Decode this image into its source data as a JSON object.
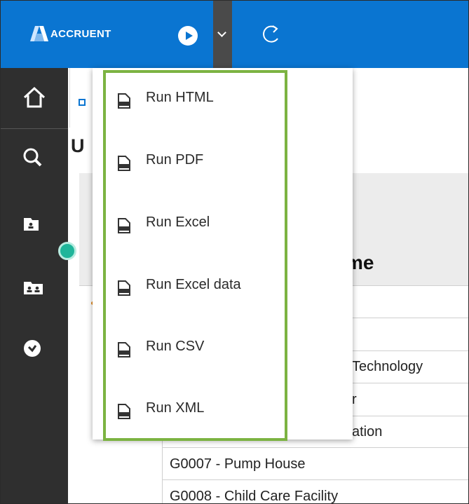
{
  "topbar": {
    "logo_text": "ACCRUENT",
    "brand_color": "#0a75d1"
  },
  "sidebar": {
    "items": [
      {
        "icon": "home-icon"
      },
      {
        "icon": "search-icon"
      },
      {
        "icon": "my-folder-icon"
      },
      {
        "icon": "team-folder-icon"
      },
      {
        "icon": "schedule-icon"
      }
    ]
  },
  "content": {
    "page_title_partial": "U",
    "column_header_partial": "me"
  },
  "table": {
    "rows_partial": [
      "Technology",
      "r",
      "ation"
    ],
    "rows": [
      "G0007 - Pump House",
      "G0008 - Child Care Facility"
    ]
  },
  "run_menu": {
    "items": [
      {
        "label": "Run HTML",
        "icon": "html-file-icon"
      },
      {
        "label": "Run PDF",
        "icon": "pdf-file-icon"
      },
      {
        "label": "Run Excel",
        "icon": "xls-file-icon"
      },
      {
        "label": "Run Excel data",
        "icon": "xls-data-file-icon"
      },
      {
        "label": "Run CSV",
        "icon": "csv-file-icon"
      },
      {
        "label": "Run XML",
        "icon": "xml-file-icon"
      }
    ],
    "highlight_color": "#7cb342"
  }
}
